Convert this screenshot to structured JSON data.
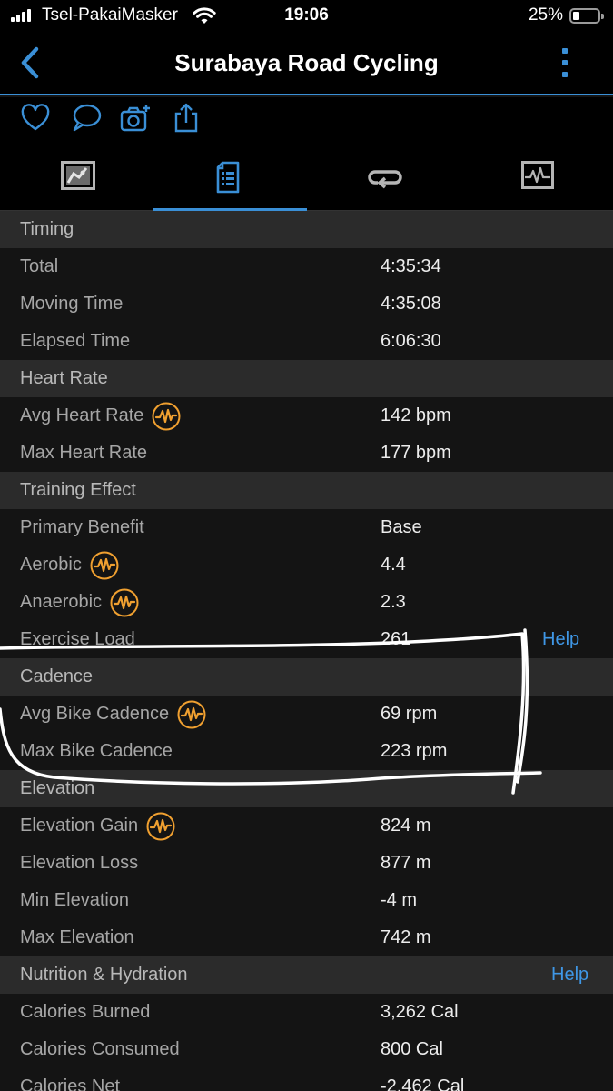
{
  "status_bar": {
    "carrier": "Tsel-PakaiMasker",
    "time": "19:06",
    "battery_percent": "25%"
  },
  "nav": {
    "title": "Surabaya Road Cycling",
    "back_icon": "chevron-left-icon",
    "more_icon": "more-vertical-icon"
  },
  "actions": [
    "heart-icon",
    "comment-icon",
    "add-photo-icon",
    "share-icon"
  ],
  "tabs": [
    {
      "icon": "map-icon",
      "active": false
    },
    {
      "icon": "stats-list-icon",
      "active": true
    },
    {
      "icon": "laps-icon",
      "active": false
    },
    {
      "icon": "chart-icon",
      "active": false
    }
  ],
  "sections": {
    "timing": {
      "title": "Timing",
      "rows": [
        {
          "label": "Total",
          "value": "4:35:34"
        },
        {
          "label": "Moving Time",
          "value": "4:35:08"
        },
        {
          "label": "Elapsed Time",
          "value": "6:06:30"
        }
      ]
    },
    "heart_rate": {
      "title": "Heart Rate",
      "rows": [
        {
          "label": "Avg Heart Rate",
          "value": "142 bpm"
        },
        {
          "label": "Max Heart Rate",
          "value": "177 bpm"
        }
      ]
    },
    "training_effect": {
      "title": "Training Effect",
      "rows": [
        {
          "label": "Primary Benefit",
          "value": "Base"
        },
        {
          "label": "Aerobic",
          "value": "4.4"
        },
        {
          "label": "Anaerobic",
          "value": "2.3"
        },
        {
          "label": "Exercise Load",
          "value": "261",
          "help": "Help"
        }
      ]
    },
    "cadence": {
      "title": "Cadence",
      "rows": [
        {
          "label": "Avg Bike Cadence",
          "value": "69 rpm"
        },
        {
          "label": "Max Bike Cadence",
          "value": "223 rpm"
        }
      ]
    },
    "elevation": {
      "title": "Elevation",
      "rows": [
        {
          "label": "Elevation Gain",
          "value": "824 m"
        },
        {
          "label": "Elevation Loss",
          "value": "877 m"
        },
        {
          "label": "Min Elevation",
          "value": "-4 m"
        },
        {
          "label": "Max Elevation",
          "value": "742 m"
        }
      ]
    },
    "nutrition": {
      "title": "Nutrition & Hydration",
      "help": "Help",
      "rows": [
        {
          "label": "Calories Burned",
          "value": "3,262 Cal"
        },
        {
          "label": "Calories Consumed",
          "value": "800 Cal"
        },
        {
          "label": "Calories Net",
          "value": "-2,462 Cal"
        }
      ]
    }
  },
  "colors": {
    "accent": "#3a8fd6",
    "badge": "#f0a030",
    "annotation": "#ffffff"
  }
}
